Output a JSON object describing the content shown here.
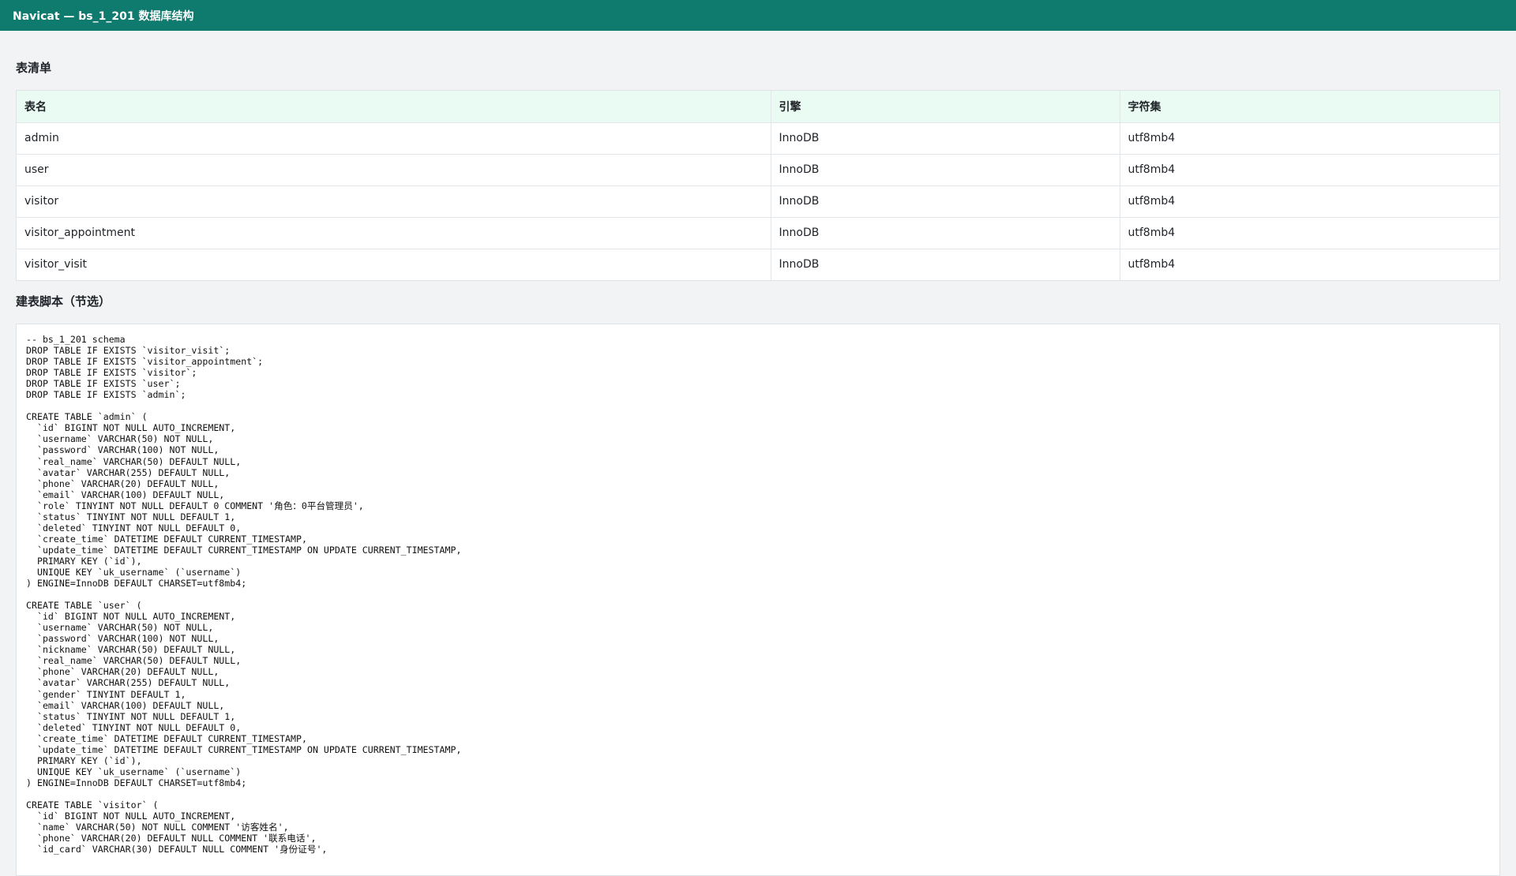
{
  "window": {
    "title": "Navicat — bs_1_201 数据库结构"
  },
  "tables_section": {
    "title": "表清单",
    "columns": [
      "表名",
      "引擎",
      "字符集"
    ],
    "rows": [
      {
        "name": "admin",
        "engine": "InnoDB",
        "charset": "utf8mb4"
      },
      {
        "name": "user",
        "engine": "InnoDB",
        "charset": "utf8mb4"
      },
      {
        "name": "visitor",
        "engine": "InnoDB",
        "charset": "utf8mb4"
      },
      {
        "name": "visitor_appointment",
        "engine": "InnoDB",
        "charset": "utf8mb4"
      },
      {
        "name": "visitor_visit",
        "engine": "InnoDB",
        "charset": "utf8mb4"
      }
    ]
  },
  "script_section": {
    "title": "建表脚本（节选）",
    "code": "-- bs_1_201 schema\nDROP TABLE IF EXISTS `visitor_visit`;\nDROP TABLE IF EXISTS `visitor_appointment`;\nDROP TABLE IF EXISTS `visitor`;\nDROP TABLE IF EXISTS `user`;\nDROP TABLE IF EXISTS `admin`;\n\nCREATE TABLE `admin` (\n  `id` BIGINT NOT NULL AUTO_INCREMENT,\n  `username` VARCHAR(50) NOT NULL,\n  `password` VARCHAR(100) NOT NULL,\n  `real_name` VARCHAR(50) DEFAULT NULL,\n  `avatar` VARCHAR(255) DEFAULT NULL,\n  `phone` VARCHAR(20) DEFAULT NULL,\n  `email` VARCHAR(100) DEFAULT NULL,\n  `role` TINYINT NOT NULL DEFAULT 0 COMMENT '角色：0平台管理员',\n  `status` TINYINT NOT NULL DEFAULT 1,\n  `deleted` TINYINT NOT NULL DEFAULT 0,\n  `create_time` DATETIME DEFAULT CURRENT_TIMESTAMP,\n  `update_time` DATETIME DEFAULT CURRENT_TIMESTAMP ON UPDATE CURRENT_TIMESTAMP,\n  PRIMARY KEY (`id`),\n  UNIQUE KEY `uk_username` (`username`)\n) ENGINE=InnoDB DEFAULT CHARSET=utf8mb4;\n\nCREATE TABLE `user` (\n  `id` BIGINT NOT NULL AUTO_INCREMENT,\n  `username` VARCHAR(50) NOT NULL,\n  `password` VARCHAR(100) NOT NULL,\n  `nickname` VARCHAR(50) DEFAULT NULL,\n  `real_name` VARCHAR(50) DEFAULT NULL,\n  `phone` VARCHAR(20) DEFAULT NULL,\n  `avatar` VARCHAR(255) DEFAULT NULL,\n  `gender` TINYINT DEFAULT 1,\n  `email` VARCHAR(100) DEFAULT NULL,\n  `status` TINYINT NOT NULL DEFAULT 1,\n  `deleted` TINYINT NOT NULL DEFAULT 0,\n  `create_time` DATETIME DEFAULT CURRENT_TIMESTAMP,\n  `update_time` DATETIME DEFAULT CURRENT_TIMESTAMP ON UPDATE CURRENT_TIMESTAMP,\n  PRIMARY KEY (`id`),\n  UNIQUE KEY `uk_username` (`username`)\n) ENGINE=InnoDB DEFAULT CHARSET=utf8mb4;\n\nCREATE TABLE `visitor` (\n  `id` BIGINT NOT NULL AUTO_INCREMENT,\n  `name` VARCHAR(50) NOT NULL COMMENT '访客姓名',\n  `phone` VARCHAR(20) DEFAULT NULL COMMENT '联系电话',\n  `id_card` VARCHAR(30) DEFAULT NULL COMMENT '身份证号',"
  }
}
